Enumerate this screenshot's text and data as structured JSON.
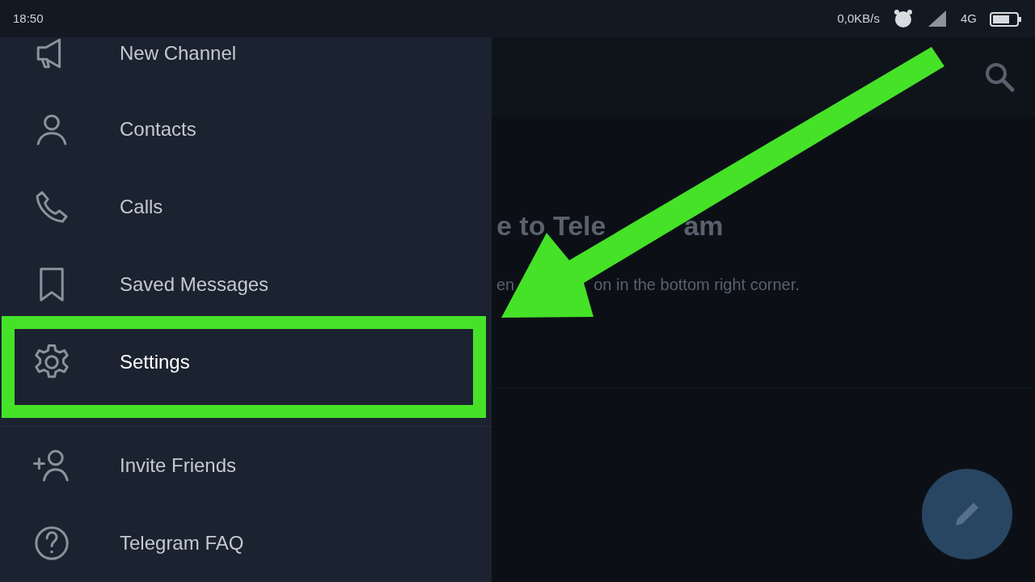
{
  "status_bar": {
    "time": "18:50",
    "network_speed": "0,0KB/s",
    "network_type": "4G"
  },
  "drawer": {
    "items": [
      {
        "label": "New Channel",
        "highlighted": false
      },
      {
        "label": "Contacts",
        "highlighted": false
      },
      {
        "label": "Calls",
        "highlighted": false
      },
      {
        "label": "Saved Messages",
        "highlighted": false
      },
      {
        "label": "Settings",
        "highlighted": true
      },
      {
        "label": "Invite Friends",
        "highlighted": false
      },
      {
        "label": "Telegram FAQ",
        "highlighted": false
      }
    ]
  },
  "welcome": {
    "title_parts": [
      "e to Tele",
      "am"
    ],
    "subtitle_parts": [
      "en",
      "on in the bottom right corner."
    ]
  }
}
